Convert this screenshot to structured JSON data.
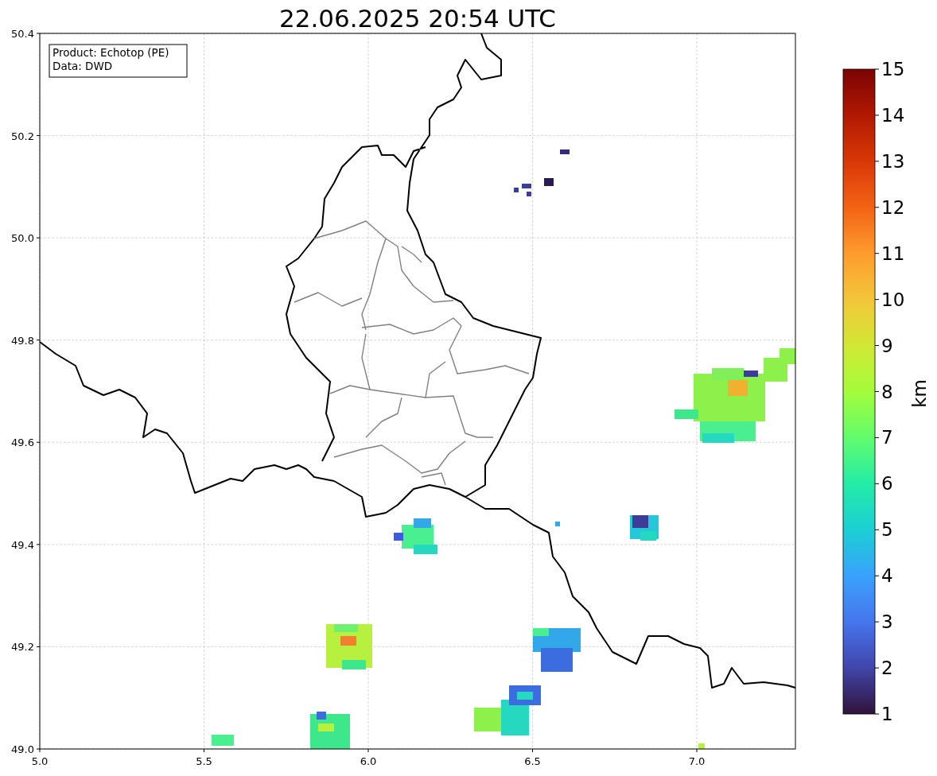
{
  "title": "22.06.2025 20:54 UTC",
  "info_box": {
    "lines": [
      "Product: Echotop (PE)",
      "Data: DWD"
    ]
  },
  "x_ticks": [
    "5.0",
    "5.5",
    "6.0",
    "6.5",
    "7.0"
  ],
  "y_ticks": [
    "50.4",
    "50.2",
    "50.0",
    "49.8",
    "49.6",
    "49.4",
    "49.2",
    "49.0"
  ],
  "colorbar": {
    "label": "km",
    "ticks": [
      "15",
      "14",
      "13",
      "12",
      "11",
      "10",
      "9",
      "8",
      "7",
      "6",
      "5",
      "4",
      "3",
      "2",
      "1"
    ]
  }
}
